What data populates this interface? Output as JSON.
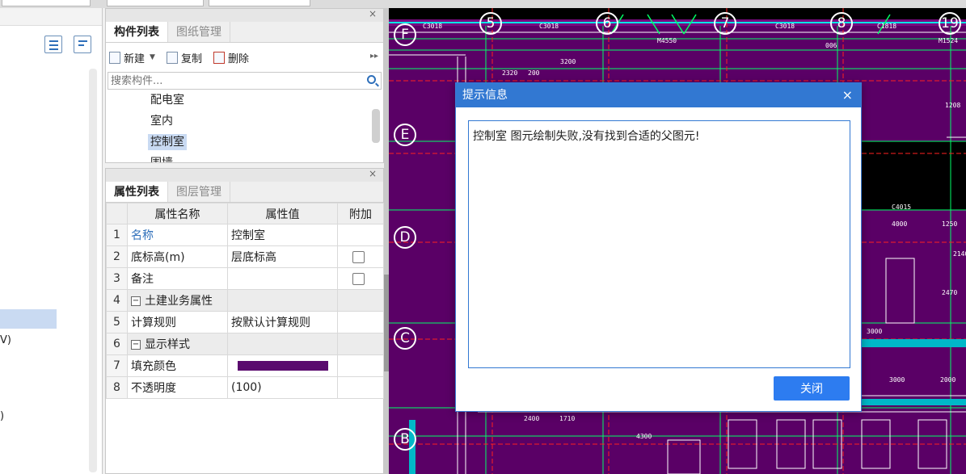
{
  "left_nav": {
    "fragments": [
      "V)",
      ")"
    ]
  },
  "components_panel": {
    "close": "×",
    "tabs": [
      {
        "label": "构件列表",
        "active": true
      },
      {
        "label": "图纸管理",
        "active": false
      }
    ],
    "toolbar": {
      "new_label": "新建",
      "copy_label": "复制",
      "delete_label": "删除",
      "more": "▸▸"
    },
    "search": {
      "placeholder": "搜索构件..."
    },
    "items": [
      {
        "label": "配电室",
        "selected": false
      },
      {
        "label": "室内",
        "selected": false
      },
      {
        "label": "控制室",
        "selected": true
      },
      {
        "label": "围墙",
        "selected": false
      }
    ]
  },
  "properties_panel": {
    "close": "×",
    "tabs": [
      {
        "label": "属性列表",
        "active": true
      },
      {
        "label": "图层管理",
        "active": false
      }
    ],
    "columns": [
      "属性名称",
      "属性值",
      "附加"
    ],
    "rows": [
      {
        "num": "1",
        "name": "名称",
        "value": "控制室",
        "extra": ""
      },
      {
        "num": "2",
        "name": "底标高(m)",
        "value": "层底标高",
        "extra": "checkbox"
      },
      {
        "num": "3",
        "name": "备注",
        "value": "",
        "extra": "checkbox"
      },
      {
        "num": "4",
        "name": "土建业务属性",
        "value": "",
        "extra": ""
      },
      {
        "num": "5",
        "name": "计算规则",
        "value": "按默认计算规则",
        "extra": ""
      },
      {
        "num": "6",
        "name": "显示样式",
        "value": "",
        "extra": ""
      },
      {
        "num": "7",
        "name": "填充颜色",
        "value": "",
        "extra": ""
      },
      {
        "num": "8",
        "name": "不透明度",
        "value": "(100)",
        "extra": ""
      }
    ],
    "fill_color": "#5a0a6e"
  },
  "canvas": {
    "axis_numbers": [
      "5",
      "6",
      "7",
      "8",
      "19"
    ],
    "axis_letters": [
      "F",
      "E",
      "D",
      "C",
      "B"
    ],
    "labels": [
      "C3018",
      "C3018",
      "C3018",
      "C1818",
      "M4550",
      "M1524",
      "2320",
      "200",
      "3200",
      "006",
      "C4015",
      "4000",
      "1250",
      "1208",
      "3000",
      "3000",
      "2000",
      "2400",
      "1710",
      "4300",
      "2470",
      "2140"
    ],
    "background_color": "#000000",
    "room_fill_color": "#5a0066"
  },
  "dialog": {
    "title": "提示信息",
    "close": "×",
    "message": "控制室 图元绘制失败,没有找到合适的父图元!",
    "button": "关闭"
  }
}
